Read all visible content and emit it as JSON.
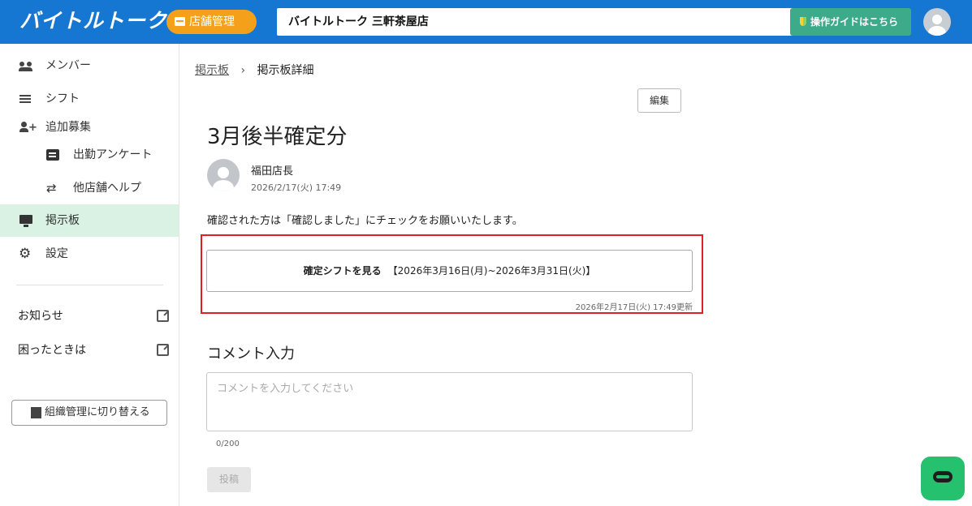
{
  "app": {
    "logo": "バイトルトーク",
    "store_button": "店舗管理",
    "store_name": "バイトルトーク 三軒茶屋店",
    "guide_button": "操作ガイドはこちら"
  },
  "sidebar": {
    "items": [
      {
        "label": "メンバー",
        "icon": "people-icon"
      },
      {
        "label": "シフト",
        "icon": "list-icon"
      },
      {
        "label": "追加募集",
        "icon": "person-add-icon"
      },
      {
        "label": "出勤アンケート",
        "icon": "form-icon"
      },
      {
        "label": "他店舗ヘルプ",
        "icon": "swap-icon"
      },
      {
        "label": "掲示板",
        "icon": "monitor-icon",
        "active": true
      },
      {
        "label": "設定",
        "icon": "gear-icon"
      }
    ],
    "links": [
      {
        "label": "お知らせ",
        "icon": "open-in-new-icon"
      },
      {
        "label": "困ったときは",
        "icon": "open-in-new-icon"
      }
    ],
    "switch_button": "組織管理に切り替える"
  },
  "breadcrumb": {
    "parent": "掲示板",
    "separator": "›",
    "current": "掲示板詳細"
  },
  "post": {
    "edit_button": "編集",
    "title": "3月後半確定分",
    "author": "福田店長",
    "posted_at": "2026/2/17(火) 17:49",
    "body": "確認された方は「確認しました」にチェックをお願いいたします。",
    "shift_link_label": "確定シフトを見る",
    "shift_period": "【2026年3月16日(月)~2026年3月31日(火)】",
    "updated": "2026年2月17日(火) 17:49更新"
  },
  "comment": {
    "title": "コメント入力",
    "placeholder": "コメントを入力してください",
    "value": "",
    "counter": "0/200",
    "submit": "投稿"
  },
  "colors": {
    "header": "#1677d2",
    "accent": "#f5a01b",
    "guide": "#3daa8a",
    "active": "#d9f2e4",
    "highlight": "#e02020",
    "chat": "#25c16f"
  }
}
